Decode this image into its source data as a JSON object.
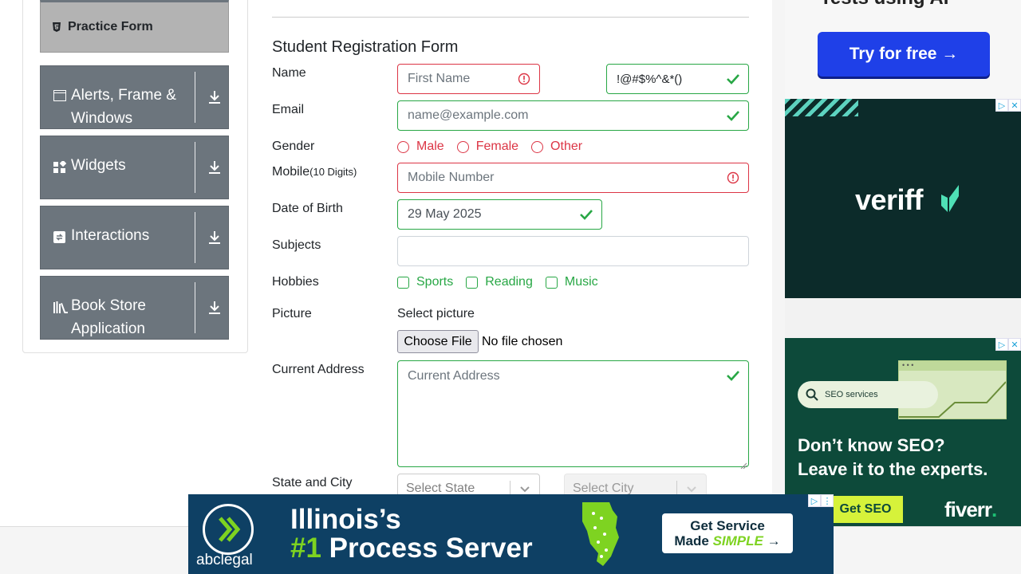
{
  "sidebar": {
    "active_item": "Practice Form",
    "groups": [
      {
        "label": "Alerts, Frame & Windows"
      },
      {
        "label": "Widgets"
      },
      {
        "label": "Interactions"
      },
      {
        "label": "Book Store Application"
      }
    ]
  },
  "form": {
    "title": "Student Registration Form",
    "name": {
      "label": "Name",
      "first_placeholder": "First Name",
      "last_value": "!@#$%^&*()"
    },
    "email": {
      "label": "Email",
      "placeholder": "name@example.com"
    },
    "gender": {
      "label": "Gender",
      "options": [
        "Male",
        "Female",
        "Other"
      ]
    },
    "mobile": {
      "label": "Mobile",
      "hint": "(10 Digits)",
      "placeholder": "Mobile Number"
    },
    "dob": {
      "label": "Date of Birth",
      "value": "29 May 2025"
    },
    "subjects": {
      "label": "Subjects",
      "value": ""
    },
    "hobbies": {
      "label": "Hobbies",
      "options": [
        "Sports",
        "Reading",
        "Music"
      ]
    },
    "picture": {
      "label": "Picture",
      "prompt": "Select picture",
      "button": "Choose File",
      "status": "No file chosen"
    },
    "address": {
      "label": "Current Address",
      "placeholder": "Current Address"
    },
    "state_city": {
      "label": "State and City",
      "state_placeholder": "Select State",
      "city_placeholder": "Select City"
    }
  },
  "ads": {
    "top": {
      "partial_text": "Tests using AI",
      "button": "Try for free →"
    },
    "veriff": {
      "brand": "veriff"
    },
    "fiverr": {
      "search_text": "SEO services",
      "headline_1": "Don’t know SEO?",
      "headline_2": "Leave it to the experts.",
      "cta": "Get SEO",
      "brand": "fiverr",
      "brand_dot": "."
    },
    "bottom": {
      "brand": "abclegal",
      "headline_1": "Illinois’s",
      "headline_2_hl": "#1",
      "headline_2_rest": " Process Server",
      "cta_line_1": "Get Service",
      "cta_line_2_prefix": "Made ",
      "cta_line_2_hl": "SIMPLE",
      "cta_arrow": " →"
    }
  },
  "colors": {
    "invalid": "#dc3545",
    "valid": "#28a745",
    "sidebar": "#6c757d",
    "active": "#b3b3b3"
  }
}
